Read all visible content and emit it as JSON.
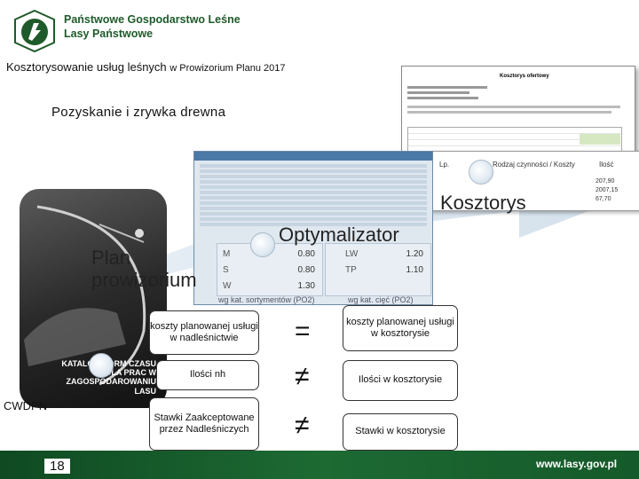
{
  "header": {
    "org_line1": "Państwowe Gospodarstwo Leśne",
    "org_line2": "Lasy Państwowe",
    "logo_text": "LASY PAŃSTWOWE"
  },
  "title_main": "Kosztorysowanie usług leśnych",
  "title_small": "w Prowizorium Planu 2017",
  "subtitle": "Pozyskanie i zrywka drewna",
  "stages": {
    "plan_line1": "Plan",
    "plan_line2": "prowizorium",
    "optimizer": "Optymalizator",
    "estimate": "Kosztorys"
  },
  "catalog_text": "KATALOG NORM CZASU DLA PRAC W ZAGOSPODAROWANIU LASU",
  "cwdpn_label": "CWDPN",
  "app_sliders": {
    "left": [
      {
        "label": "M",
        "value": "0.80"
      },
      {
        "label": "S",
        "value": "0.80"
      },
      {
        "label": "W",
        "value": "1.30"
      }
    ],
    "right": [
      {
        "label": "LW",
        "value": "1.20"
      },
      {
        "label": "TP",
        "value": "1.10"
      }
    ],
    "left_caption": "wg kat. sortymentów (PO2)",
    "right_caption": "wg kat. cięć (PO2)"
  },
  "doc_values": [
    "207,90",
    "2007,15",
    "67,70"
  ],
  "doc_header": "Kosztorys ofertowy",
  "doc_cols": [
    "Lp.",
    "Rodzaj czynności / Koszty",
    "Ilość"
  ],
  "comparison": {
    "left": [
      "koszty planowanej usługi w nadleśnictwie",
      "Ilości nh",
      "Stawki Zaakceptowane przez Nadleśniczych"
    ],
    "symbols": [
      "=",
      "≠",
      "≠"
    ],
    "right": [
      "koszty planowanej usługi w kosztorysie",
      "Ilości w kosztorysie",
      "Stawki w kosztorysie"
    ]
  },
  "footer": {
    "page_number": "18",
    "url": "www.lasy.gov.pl"
  }
}
